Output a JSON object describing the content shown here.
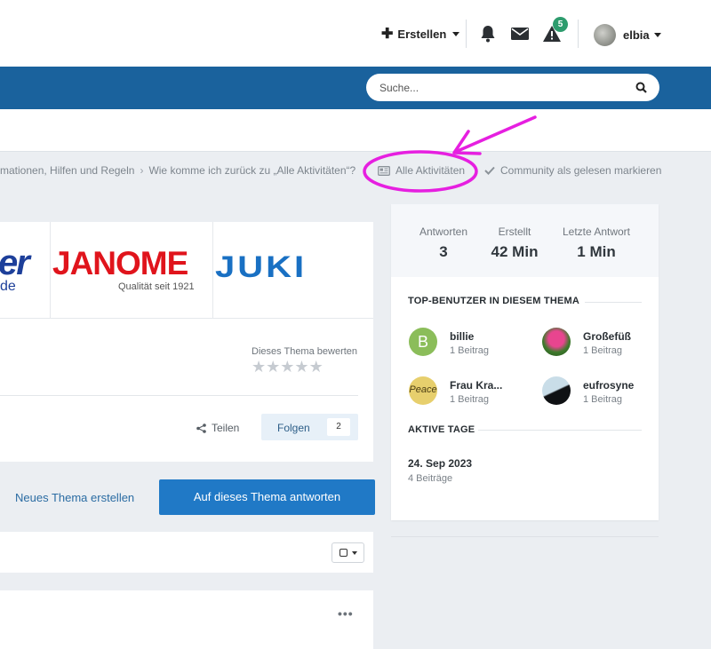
{
  "header": {
    "create_label": "Erstellen",
    "notifications_badge": "5",
    "username": "elbia"
  },
  "search": {
    "placeholder": "Suche..."
  },
  "breadcrumb": {
    "items": [
      "mationen, Hilfen und Regeln",
      "Wie komme ich zurück zu „Alle Aktivitäten“?"
    ],
    "all_activity": "Alle Aktivitäten",
    "mark_read": "Community als gelesen markieren"
  },
  "banner": {
    "logo_partial_text": "er",
    "logo_partial_sub": "de",
    "janome": "JANOME",
    "janome_tagline": "Qualität seit 1921",
    "juki": "JUKI"
  },
  "topic": {
    "rate_label": "Dieses Thema bewerten",
    "rating": 0,
    "share_label": "Teilen",
    "follow_label": "Folgen",
    "follow_count": "2",
    "new_topic": "Neues Thema erstellen",
    "reply": "Auf dieses Thema antworten"
  },
  "sidebar": {
    "stats": [
      {
        "label": "Antworten",
        "value": "3"
      },
      {
        "label": "Erstellt",
        "value": "42 Min"
      },
      {
        "label": "Letzte Antwort",
        "value": "1 Min"
      }
    ],
    "top_users_title": "TOP-BENUTZER IN DIESEM THEMA",
    "users": [
      {
        "name": "billie",
        "count": "1 Beitrag",
        "initial": "B"
      },
      {
        "name": "Großefüß",
        "count": "1 Beitrag"
      },
      {
        "name": "Frau Kra...",
        "count": "1 Beitrag",
        "avatar_text": "Peace"
      },
      {
        "name": "eufrosyne",
        "count": "1 Beitrag"
      }
    ],
    "active_days_title": "AKTIVE TAGE",
    "day": "24. Sep 2023",
    "day_count": "4 Beiträge"
  },
  "colors": {
    "nav_blue": "#1a629d",
    "button_blue": "#2079c6",
    "annotation_magenta": "#e61fe0",
    "badge_green": "#2e9c6e"
  }
}
